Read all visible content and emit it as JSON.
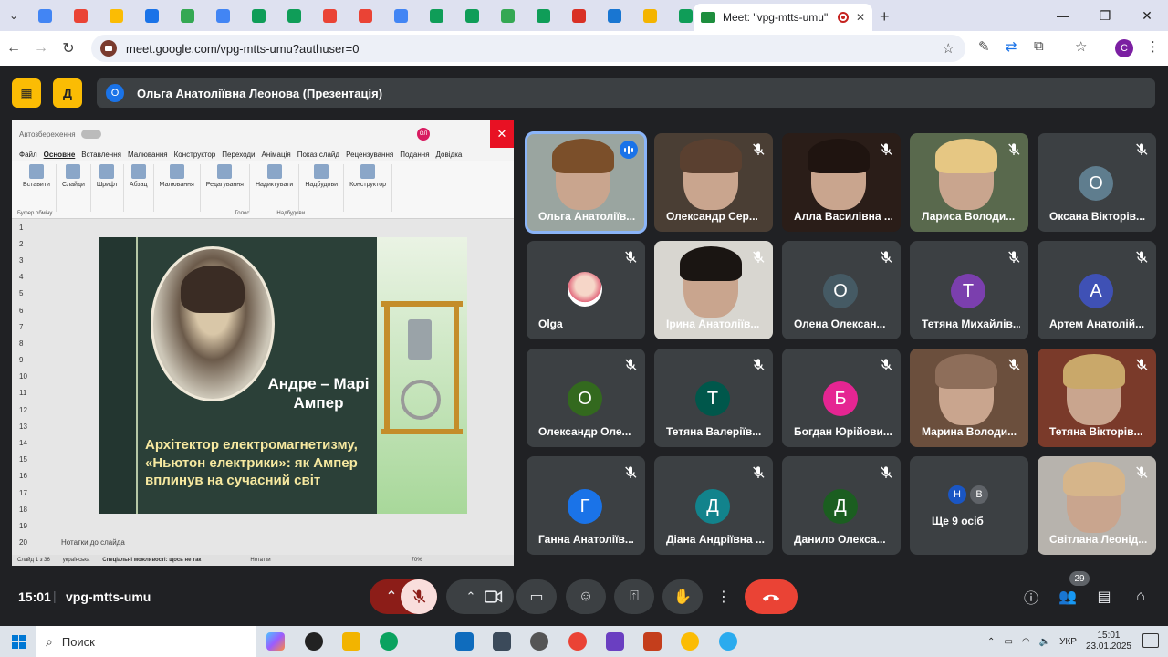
{
  "browser": {
    "active_tab_title": "Meet: \"vpg-mtts-umu\"",
    "url": "meet.google.com/vpg-mtts-umu?authuser=0",
    "profile_initial": "C",
    "pinned_tab_colors": [
      "#4285f4",
      "#ea4335",
      "#fbbc04",
      "#1a73e8",
      "#34a853",
      "#4285f4",
      "#0f9d58",
      "#0f9d58",
      "#ea4335",
      "#ea4335",
      "#4285f4",
      "#0f9d58",
      "#0f9d58",
      "#34a853",
      "#0f9d58",
      "#d93025",
      "#1976d2",
      "#f4b400",
      "#0f9d58"
    ]
  },
  "presenter_bar": {
    "avatar_initial": "О",
    "title": "Ольга Анатоліївна Леонова (Презентація)"
  },
  "presentation": {
    "autosave_label": "Автозбереження",
    "user_badge": "ОЛ",
    "menu": [
      "Файл",
      "Основне",
      "Вставлення",
      "Малювання",
      "Конструктор",
      "Переходи",
      "Анімація",
      "Показ слайд",
      "Рецензування",
      "Подання",
      "Довідка"
    ],
    "ribbon": [
      "Вставити",
      "Слайди",
      "Шрифт",
      "Абзац",
      "Малювання",
      "Редагування",
      "Надиктувати",
      "Надбудови",
      "Конструктор"
    ],
    "ribbon_groups": [
      "Буфер обміну",
      "Голос",
      "Надбудови"
    ],
    "slide_numbers": [
      "1",
      "2",
      "3",
      "4",
      "5",
      "6",
      "7",
      "8",
      "9",
      "10",
      "11",
      "12",
      "13",
      "14",
      "15",
      "16",
      "17",
      "18",
      "19",
      "20"
    ],
    "slide": {
      "name_line1": "Андре – Марі",
      "name_line2": "Ампер",
      "subtitle": "Архітектор електромагнетизму, «Ньютон електрики»: як Ампер вплинув на сучасний світ"
    },
    "notes_placeholder": "Нотатки до слайда",
    "status": {
      "slide_count": "Слайд 1 з 36",
      "language": "українська",
      "accessibility": "Спеціальні можливості: щось не так",
      "notes": "Нотатки",
      "zoom": "70%"
    }
  },
  "participants": [
    {
      "name": "Ольга Анатоліїв...",
      "type": "video",
      "speaking": true,
      "muted": false
    },
    {
      "name": "Олександр Сер...",
      "type": "video",
      "muted": true
    },
    {
      "name": "Алла Василівна ...",
      "type": "video",
      "muted": true
    },
    {
      "name": "Лариса Володи...",
      "type": "video",
      "muted": true
    },
    {
      "name": "Оксана Вікторів...",
      "type": "avatar",
      "initial": "О",
      "color": "#5f7d8e",
      "muted": true
    },
    {
      "name": "Olga",
      "type": "photo",
      "muted": true
    },
    {
      "name": "Ірина Анатоліїв...",
      "type": "video",
      "muted": true
    },
    {
      "name": "Олена Олексан...",
      "type": "avatar",
      "initial": "О",
      "color": "#455a64",
      "muted": true
    },
    {
      "name": "Тетяна Михайлів...",
      "type": "avatar",
      "initial": "Т",
      "color": "#7b3fae",
      "muted": true
    },
    {
      "name": "Артем Анатолій...",
      "type": "avatar",
      "initial": "А",
      "color": "#3f51b5",
      "muted": true
    },
    {
      "name": "Олександр Оле...",
      "type": "avatar",
      "initial": "О",
      "color": "#33691e",
      "muted": true
    },
    {
      "name": "Тетяна Валеріїв...",
      "type": "avatar",
      "initial": "Т",
      "color": "#00574b",
      "muted": true
    },
    {
      "name": "Богдан Юрійови...",
      "type": "avatar",
      "initial": "Б",
      "color": "#e52592",
      "muted": true
    },
    {
      "name": "Марина Володи...",
      "type": "video",
      "muted": true
    },
    {
      "name": "Тетяна Вікторів...",
      "type": "video",
      "muted": true
    },
    {
      "name": "Ганна Анатоліїв...",
      "type": "avatar",
      "initial": "Г",
      "color": "#1a73e8",
      "muted": true
    },
    {
      "name": "Діана Андріївна ...",
      "type": "avatar",
      "initial": "Д",
      "color": "#12838c",
      "muted": true
    },
    {
      "name": "Данило Олекса...",
      "type": "avatar",
      "initial": "Д",
      "color": "#1b5e20",
      "muted": true
    },
    {
      "name": "Ще 9 осіб",
      "type": "more",
      "initials": [
        "Н",
        "В"
      ],
      "muted": false
    },
    {
      "name": "Світлана Леонід...",
      "type": "video",
      "muted": true
    }
  ],
  "footer": {
    "time": "15:01",
    "meeting_code": "vpg-mtts-umu",
    "participant_count": "29"
  },
  "taskbar": {
    "search_label": "Поиск",
    "language": "УКР",
    "time": "15:01",
    "date": "23.01.2025"
  }
}
